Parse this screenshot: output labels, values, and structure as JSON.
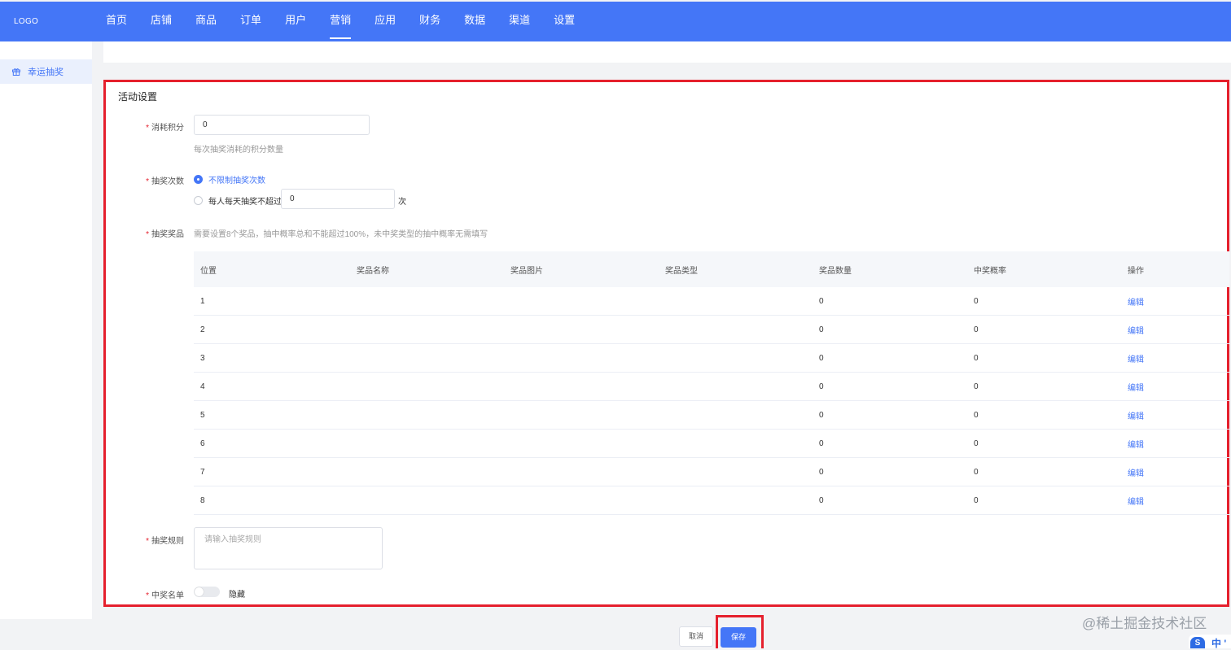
{
  "header": {
    "logo": "LOGO",
    "nav": [
      "首页",
      "店铺",
      "商品",
      "订单",
      "用户",
      "营销",
      "应用",
      "财务",
      "数据",
      "渠道",
      "设置"
    ],
    "active_nav": "营销",
    "accent_color": "#4476f7"
  },
  "sidebar": {
    "items": [
      {
        "label": "幸运抽奖",
        "icon": "gift-icon",
        "active": true
      }
    ]
  },
  "card": {
    "title": "活动设置",
    "highlight_color": "#e5202d"
  },
  "form": {
    "points": {
      "label": "消耗积分",
      "value": "0",
      "hint": "每次抽奖消耗的积分数量"
    },
    "draw_times": {
      "label": "抽奖次数",
      "option_unlimited": "不限制抽奖次数",
      "option_daily": "每人每天抽奖不超过",
      "daily_value": "0",
      "daily_unit": "次",
      "selected": "不限制抽奖次数"
    },
    "prizes": {
      "label": "抽奖奖品",
      "hint": "需要设置8个奖品，抽中概率总和不能超过100%，未中奖类型的抽中概率无需填写",
      "columns": [
        "位置",
        "奖品名称",
        "奖品图片",
        "奖品类型",
        "奖品数量",
        "中奖概率",
        "操作"
      ],
      "rows": [
        {
          "position": "1",
          "name": "",
          "image": "",
          "type": "",
          "quantity": "0",
          "probability": "0",
          "action": "编辑"
        },
        {
          "position": "2",
          "name": "",
          "image": "",
          "type": "",
          "quantity": "0",
          "probability": "0",
          "action": "编辑"
        },
        {
          "position": "3",
          "name": "",
          "image": "",
          "type": "",
          "quantity": "0",
          "probability": "0",
          "action": "编辑"
        },
        {
          "position": "4",
          "name": "",
          "image": "",
          "type": "",
          "quantity": "0",
          "probability": "0",
          "action": "编辑"
        },
        {
          "position": "5",
          "name": "",
          "image": "",
          "type": "",
          "quantity": "0",
          "probability": "0",
          "action": "编辑"
        },
        {
          "position": "6",
          "name": "",
          "image": "",
          "type": "",
          "quantity": "0",
          "probability": "0",
          "action": "编辑"
        },
        {
          "position": "7",
          "name": "",
          "image": "",
          "type": "",
          "quantity": "0",
          "probability": "0",
          "action": "编辑"
        },
        {
          "position": "8",
          "name": "",
          "image": "",
          "type": "",
          "quantity": "0",
          "probability": "0",
          "action": "编辑"
        }
      ]
    },
    "rules": {
      "label": "抽奖规则",
      "placeholder": "请输入抽奖规则"
    },
    "winners": {
      "label": "中奖名单",
      "switch_label": "隐藏",
      "enabled": false
    }
  },
  "footer": {
    "cancel": "取消",
    "save": "保存"
  },
  "overlay": {
    "watermark": "@稀土掘金技术社区",
    "ime_logo": "S",
    "ime_mode": "中 '"
  }
}
